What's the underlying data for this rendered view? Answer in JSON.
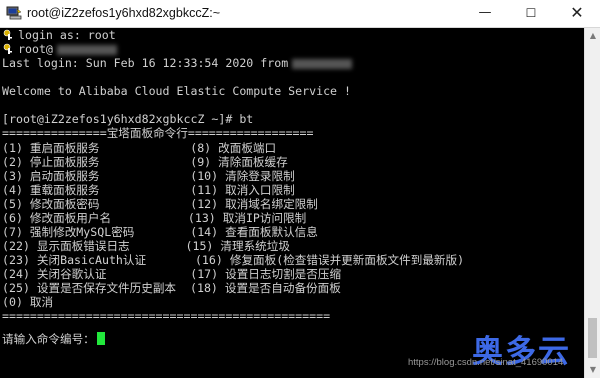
{
  "window": {
    "title": "root@iZ2zefos1y6hxd82xgbkccZ:~",
    "min_label": "—",
    "max_label": "☐",
    "close_label": "✕"
  },
  "terminal": {
    "login_as": "login as: root",
    "user_prefix": "root@",
    "last_login": "Last login: Sun Feb 16 12:33:54 2020 from",
    "welcome": "Welcome to Alibaba Cloud Elastic Compute Service !",
    "prompt": "[root@iZ2zefos1y6hxd82xgbkccZ ~]# bt",
    "menu_header": "===============宝塔面板命令行==================",
    "menu_rows": [
      "(1) 重启面板服务             (8) 改面板端口",
      "(2) 停止面板服务             (9) 清除面板缓存",
      "(3) 启动面板服务             (10) 清除登录限制",
      "(4) 重载面板服务             (11) 取消入口限制",
      "(5) 修改面板密码             (12) 取消域名绑定限制",
      "(6) 修改面板用户名           (13) 取消IP访问限制",
      "(7) 强制修改MySQL密码        (14) 查看面板默认信息",
      "(22) 显示面板错误日志        (15) 清理系统垃圾",
      "(23) 关闭BasicAuth认证       (16) 修复面板(检查错误并更新面板文件到最新版)",
      "(24) 关闭谷歌认证            (17) 设置日志切割是否压缩",
      "(25) 设置是否保存文件历史副本  (18) 设置是否自动备份面板",
      "(0) 取消"
    ],
    "menu_footer": "===============================================",
    "input_prompt": "请输入命令编号："
  },
  "scrollbar": {
    "up_arrow": "▲",
    "down_arrow": "▼"
  },
  "watermark": {
    "url": "https://blog.csdn.net/sinat_41690014",
    "logo": "奥多云"
  },
  "colors": {
    "terminal_bg": "#000000",
    "terminal_text": "#d0d0d0",
    "cursor": "#22e83c",
    "logo": "#3d69e6"
  }
}
